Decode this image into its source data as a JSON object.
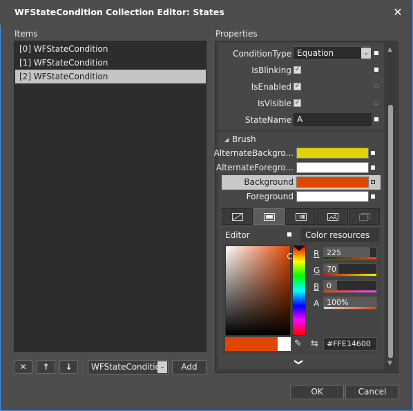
{
  "window": {
    "title": "WFStateCondition Collection Editor: States"
  },
  "items": {
    "label": "Items",
    "list": [
      "[0] WFStateCondition",
      "[1] WFStateCondition",
      "[2] WFStateCondition"
    ],
    "selected_index": 2,
    "remove_label": "✕",
    "up_label": "↑",
    "down_label": "↓",
    "type_select_value": "WFStateCondition",
    "add_label": "Add"
  },
  "properties": {
    "label": "Properties",
    "condition_type_label": "ConditionType",
    "condition_type_value": "Equation",
    "is_blinking_label": "IsBlinking",
    "is_blinking": true,
    "is_enabled_label": "IsEnabled",
    "is_enabled": true,
    "is_visible_label": "IsVisible",
    "is_visible": true,
    "state_name_label": "StateName",
    "state_name_value": "A"
  },
  "brush": {
    "header": "Brush",
    "rows": [
      {
        "label": "AlternateBackgro...",
        "color": "#E1D400"
      },
      {
        "label": "AlternateForegro...",
        "color": "#FFFFFF"
      },
      {
        "label": "Background",
        "color": "#E14600"
      },
      {
        "label": "Foreground",
        "color": "#FFFFFF"
      }
    ],
    "selected_row": 2
  },
  "editor": {
    "editor_tab": "Editor",
    "color_resources_tab": "Color resources",
    "r_label": "R",
    "r_value": "225",
    "r_fraction": 0.88,
    "g_label": "G",
    "g_value": "70",
    "g_fraction": 0.27,
    "b_label": "B",
    "b_value": "0",
    "b_fraction": 0.0,
    "a_label": "A",
    "a_value": "100%",
    "a_fraction": 1.0,
    "hex_value": "#FFE14600",
    "current_color": "#E14600",
    "original_color": "#FFFFFF"
  },
  "footer": {
    "ok_label": "OK",
    "cancel_label": "Cancel"
  },
  "colors": {
    "accent_border": "#3A8EE6",
    "selected_row": "#C4C4C4"
  }
}
